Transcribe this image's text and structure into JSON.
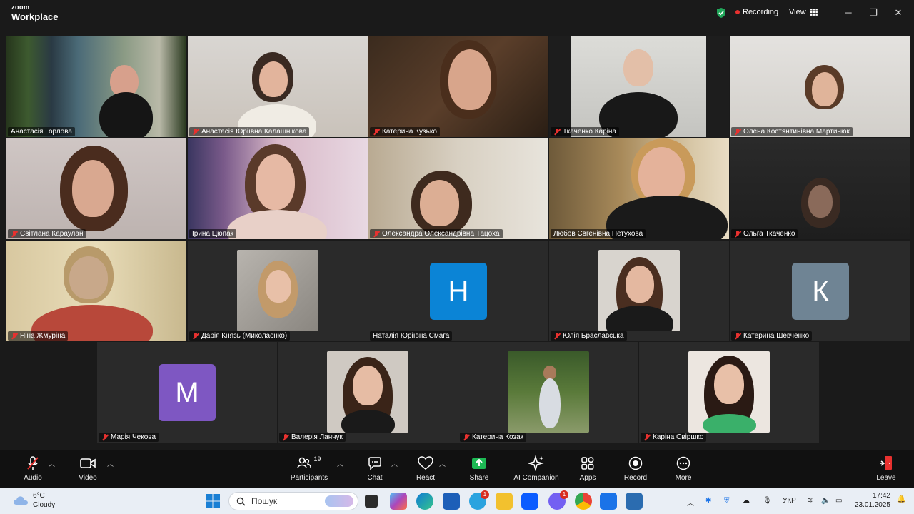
{
  "app": {
    "brand_top": "zoom",
    "brand_bottom": "Workplace"
  },
  "titlebar": {
    "recording_label": "Recording",
    "view_label": "View"
  },
  "participants": [
    {
      "name": "Анастасія Горлова",
      "muted": false,
      "active": true
    },
    {
      "name": "Анастасія Юріївна Калашнікова",
      "muted": true
    },
    {
      "name": "Катерина Кузько",
      "muted": true
    },
    {
      "name": "Ткаченко Каріна",
      "muted": true
    },
    {
      "name": "Олена Костянтинівна Мартинюк",
      "muted": true
    },
    {
      "name": "Світлана Караулан",
      "muted": true
    },
    {
      "name": "Ірина Цюпак",
      "muted": false
    },
    {
      "name": "Олександра Олександрівна Тацоха",
      "muted": true
    },
    {
      "name": "Любов Євгенівна Петухова",
      "muted": false
    },
    {
      "name": "Ольга Ткаченко",
      "muted": true
    },
    {
      "name": "Ніна Жмуріна",
      "muted": true
    },
    {
      "name": "Дарія Князь (Миколаєнко)",
      "muted": true
    },
    {
      "name": "Наталія Юріївна Смага",
      "muted": false,
      "initial": "Н",
      "avatar_color": "#0b84d6"
    },
    {
      "name": "Юлія Браславська",
      "muted": true
    },
    {
      "name": "Катерина Шевченко",
      "muted": true,
      "initial": "К",
      "avatar_color": "#6f8494"
    },
    {
      "name": "Марія Чекова",
      "muted": true,
      "initial": "М",
      "avatar_color": "#7e57c2"
    },
    {
      "name": "Валерія Ланчук",
      "muted": true
    },
    {
      "name": "Катерина Козак",
      "muted": true
    },
    {
      "name": "Каріна Свіршко",
      "muted": true
    }
  ],
  "toolbar": {
    "audio": "Audio",
    "video": "Video",
    "participants": "Participants",
    "participants_count": "19",
    "chat": "Chat",
    "react": "React",
    "share": "Share",
    "ai_companion": "AI Companion",
    "apps": "Apps",
    "record": "Record",
    "more": "More",
    "leave": "Leave",
    "share_color": "#1db954",
    "leave_color": "#e8312f"
  },
  "taskbar": {
    "temperature": "6°C",
    "weather": "Cloudy",
    "search_placeholder": "Пошук",
    "language": "УКР",
    "time": "17:42",
    "date": "23.01.2025",
    "telegram_badge": "1",
    "viber_badge": "1"
  }
}
